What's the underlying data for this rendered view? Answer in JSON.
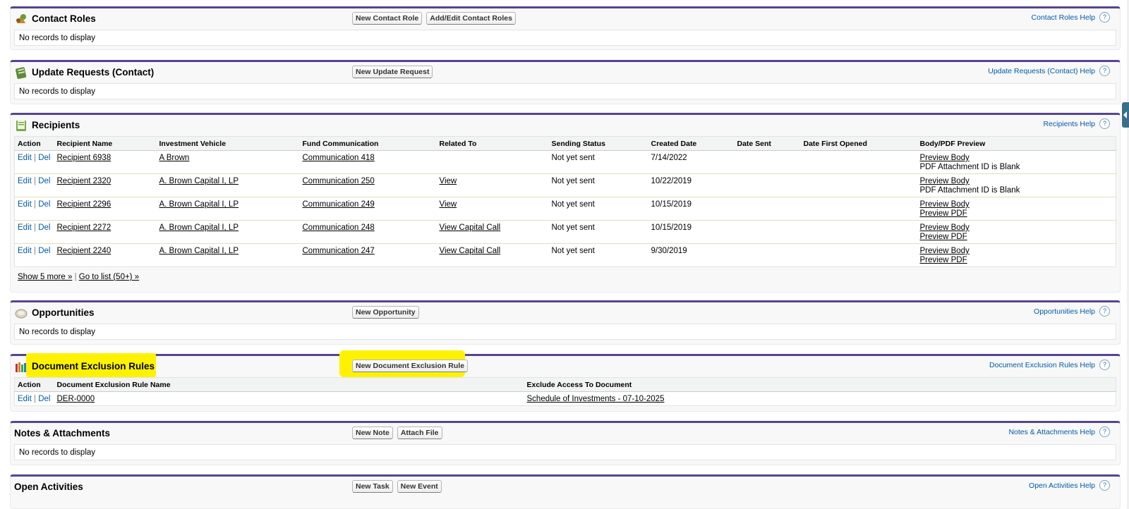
{
  "contact_roles": {
    "title": "Contact Roles",
    "buttons": [
      "New Contact Role",
      "Add/Edit Contact Roles"
    ],
    "help": "Contact Roles Help",
    "empty": "No records to display"
  },
  "update_requests": {
    "title": "Update Requests (Contact)",
    "buttons": [
      "New Update Request"
    ],
    "help": "Update Requests (Contact) Help",
    "empty": "No records to display"
  },
  "recipients": {
    "title": "Recipients",
    "help": "Recipients Help",
    "columns": [
      "Action",
      "Recipient Name",
      "Investment Vehicle",
      "Fund Communication",
      "Related To",
      "Sending Status",
      "Created Date",
      "Date Sent",
      "Date First Opened",
      "Body/PDF Preview"
    ],
    "action_edit": "Edit",
    "action_del": "Del",
    "rows": [
      {
        "name": "Recipient 6938",
        "vehicle": "A Brown",
        "communication": "Communication 418",
        "related": "",
        "status": "Not yet sent",
        "created": "7/14/2022",
        "sent": "",
        "opened": "",
        "preview1": "Preview Body",
        "preview2": "PDF Attachment ID is Blank",
        "preview2_link": false
      },
      {
        "name": "Recipient 2320",
        "vehicle": "A. Brown Capital I, LP",
        "communication": "Communication 250",
        "related": "View",
        "status": "Not yet sent",
        "created": "10/22/2019",
        "sent": "",
        "opened": "",
        "preview1": "Preview Body",
        "preview2": "PDF Attachment ID is Blank",
        "preview2_link": false
      },
      {
        "name": "Recipient 2296",
        "vehicle": "A. Brown Capital I, LP",
        "communication": "Communication 249",
        "related": "View",
        "status": "Not yet sent",
        "created": "10/15/2019",
        "sent": "",
        "opened": "",
        "preview1": "Preview Body",
        "preview2": "Preview PDF",
        "preview2_link": true
      },
      {
        "name": "Recipient 2272",
        "vehicle": "A. Brown Capital I, LP",
        "communication": "Communication 248",
        "related": "View Capital Call",
        "status": "Not yet sent",
        "created": "10/15/2019",
        "sent": "",
        "opened": "",
        "preview1": "Preview Body",
        "preview2": "Preview PDF",
        "preview2_link": true
      },
      {
        "name": "Recipient 2240",
        "vehicle": "A. Brown Capital I, LP",
        "communication": "Communication 247",
        "related": "View Capital Call",
        "status": "Not yet sent",
        "created": "9/30/2019",
        "sent": "",
        "opened": "",
        "preview1": "Preview Body",
        "preview2": "Preview PDF",
        "preview2_link": true
      }
    ],
    "show_more": "Show 5 more »",
    "footer_sep": "|",
    "go_to_list": "Go to list (50+) »"
  },
  "opportunities": {
    "title": "Opportunities",
    "buttons": [
      "New Opportunity"
    ],
    "help": "Opportunities Help",
    "empty": "No records to display"
  },
  "exclusion_rules": {
    "title": "Document Exclusion Rules",
    "buttons": [
      "New Document Exclusion Rule"
    ],
    "help": "Document Exclusion Rules Help",
    "columns": [
      "Action",
      "Document Exclusion Rule Name",
      "Exclude Access To Document"
    ],
    "rows": [
      {
        "name": "DER-0000",
        "document": "Schedule of Investments - 07-10-2025"
      }
    ]
  },
  "notes": {
    "title": "Notes & Attachments",
    "buttons": [
      "New Note",
      "Attach File"
    ],
    "help": "Notes & Attachments Help",
    "empty": "No records to display"
  },
  "activities": {
    "title": "Open Activities",
    "buttons": [
      "New Task",
      "New Event"
    ],
    "help": "Open Activities Help"
  },
  "help_glyph": "?",
  "highlight_color": "#fff200",
  "accent_color": "#56458c"
}
